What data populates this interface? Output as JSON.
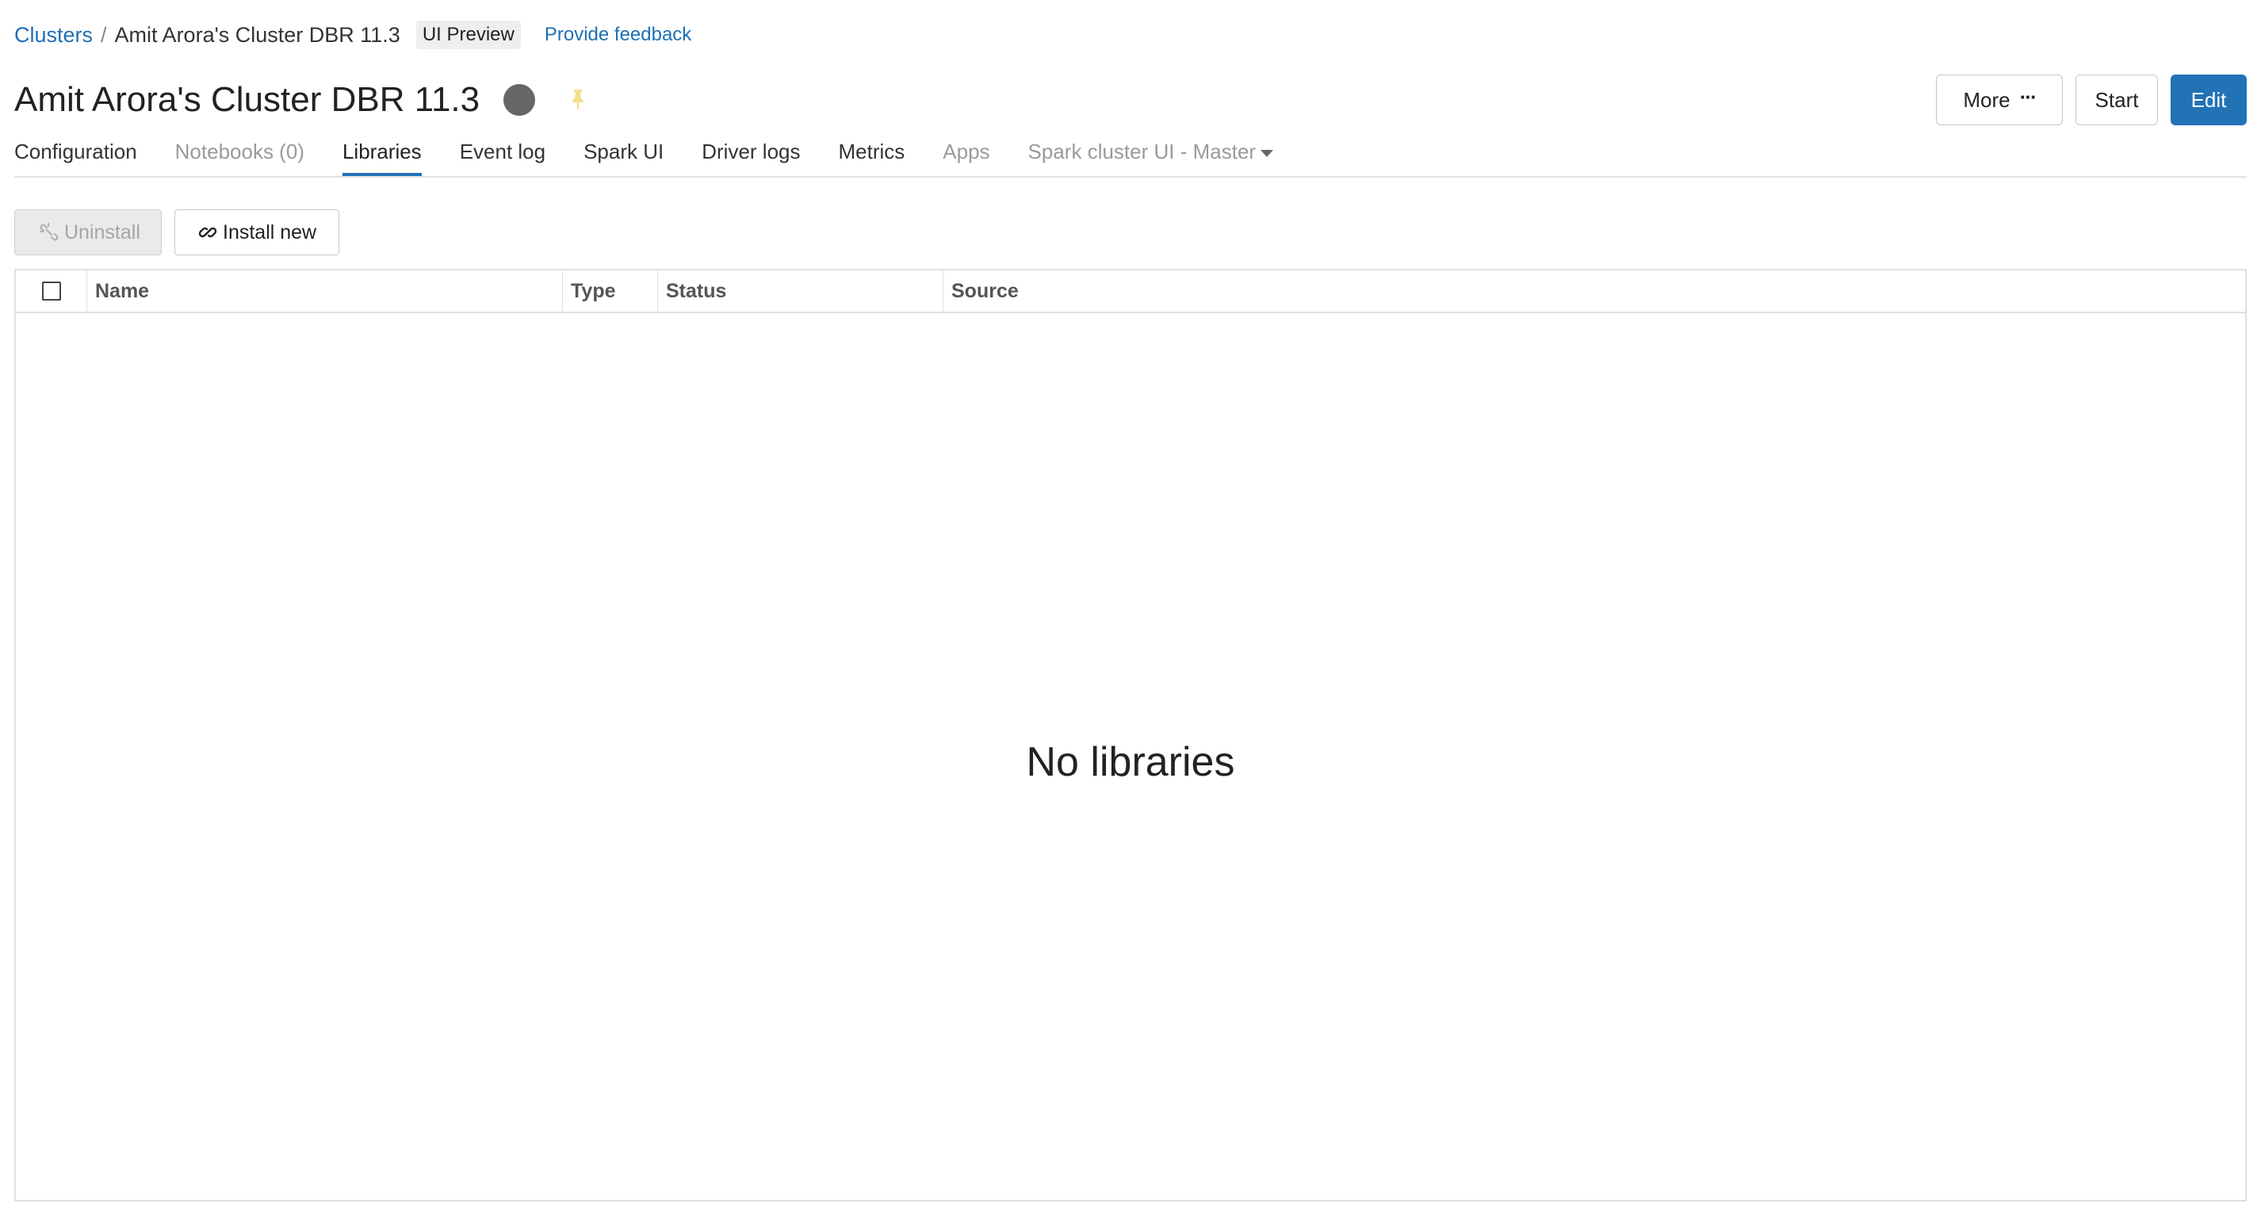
{
  "breadcrumb": {
    "root": "Clusters",
    "separator": "/",
    "current": "Amit Arora's Cluster DBR 11.3",
    "badge": "UI Preview",
    "feedback": "Provide feedback"
  },
  "header": {
    "title": "Amit Arora's Cluster DBR 11.3",
    "status_color": "#666666",
    "actions": {
      "more_label": "More",
      "more_icon": "···",
      "start_label": "Start",
      "edit_label": "Edit"
    }
  },
  "tabs": [
    {
      "label": "Configuration",
      "state": "normal"
    },
    {
      "label": "Notebooks (0)",
      "state": "disabled"
    },
    {
      "label": "Libraries",
      "state": "active"
    },
    {
      "label": "Event log",
      "state": "normal"
    },
    {
      "label": "Spark UI",
      "state": "normal"
    },
    {
      "label": "Driver logs",
      "state": "normal"
    },
    {
      "label": "Metrics",
      "state": "normal"
    },
    {
      "label": "Apps",
      "state": "disabled"
    },
    {
      "label": "Spark cluster UI - Master",
      "state": "disabled"
    }
  ],
  "toolbar": {
    "uninstall_label": "Uninstall",
    "install_label": "Install new"
  },
  "table": {
    "columns": [
      "Name",
      "Type",
      "Status",
      "Source"
    ],
    "empty_message": "No libraries"
  },
  "colors": {
    "accent": "#2272b6",
    "link": "#1f6fb5",
    "pin": "#f5dd8c"
  }
}
